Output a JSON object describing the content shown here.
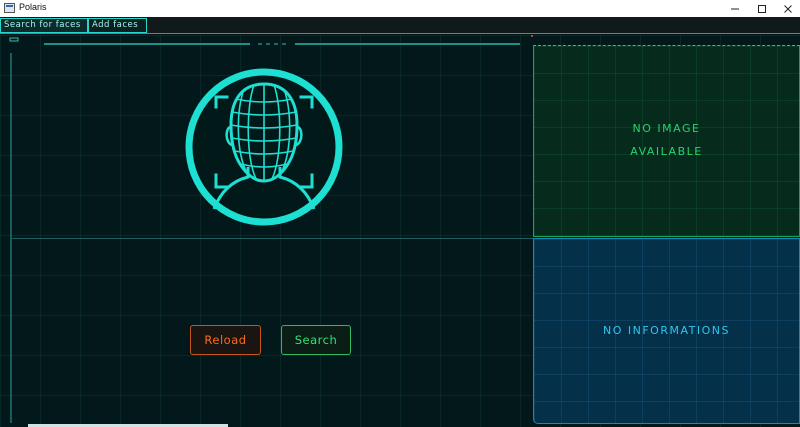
{
  "window": {
    "title": "Polaris",
    "icon": "window-app-icon",
    "controls": [
      "minimize-icon",
      "maximize-icon",
      "close-icon"
    ]
  },
  "tabs": [
    {
      "label": "Search for faces",
      "selected": true
    },
    {
      "label": "Add faces",
      "selected": false
    }
  ],
  "face_icon": "face-scan-icon",
  "buttons": {
    "reload": "Reload",
    "search": "Search"
  },
  "image_panel": {
    "line1": "NO IMAGE",
    "line2": "AVAILABLE"
  },
  "info_panel": {
    "text": "NO INFORMATIONS"
  },
  "colors": {
    "accent": "#1de0d2",
    "reload": "#ff6a1f",
    "search": "#34e07a",
    "image_panel": "#27d36d",
    "info_panel": "#30c6ea",
    "background": "#03181a"
  }
}
